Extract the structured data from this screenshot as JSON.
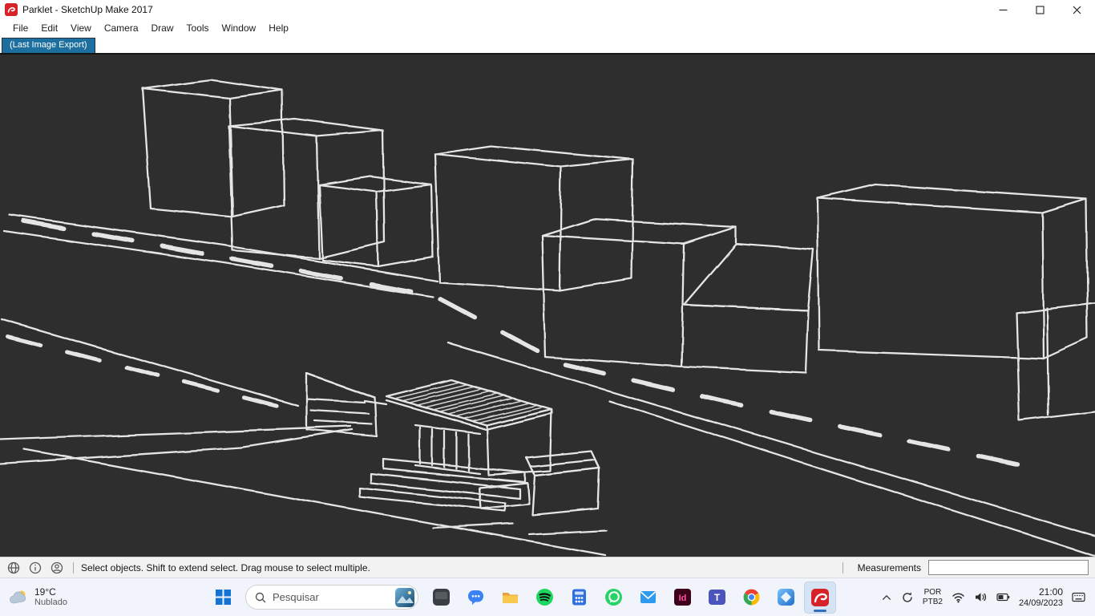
{
  "window": {
    "title": "Parklet - SketchUp Make 2017"
  },
  "menu": {
    "items": [
      "File",
      "Edit",
      "View",
      "Camera",
      "Draw",
      "Tools",
      "Window",
      "Help"
    ]
  },
  "scene_tab": {
    "label": "(Last Image Export)"
  },
  "statusbar": {
    "hint": "Select objects. Shift to extend select. Drag mouse to select multiple.",
    "measurements_label": "Measurements",
    "measurements_value": ""
  },
  "taskbar": {
    "weather": {
      "temperature": "19°C",
      "condition": "Nublado"
    },
    "search": {
      "placeholder": "Pesquisar"
    },
    "apps": {
      "names": [
        "dark-app",
        "chat",
        "file-explorer",
        "spotify",
        "calculator",
        "whatsapp",
        "mail",
        "indesign",
        "teams",
        "chrome",
        "photos",
        "sketchup"
      ],
      "indesign_glyph": "Id",
      "teams_glyph": "T"
    },
    "tray": {
      "language_primary": "POR",
      "language_secondary": "PTB2",
      "time": "21:00",
      "date": "24/09/2023"
    }
  },
  "colors": {
    "viewport_background": "#2e2e2e",
    "sketch_stroke": "#efefef",
    "scene_tab_background": "#1d6fa0",
    "sketchup_red": "#d6232a",
    "taskbar_background": "#f1f4fa"
  }
}
